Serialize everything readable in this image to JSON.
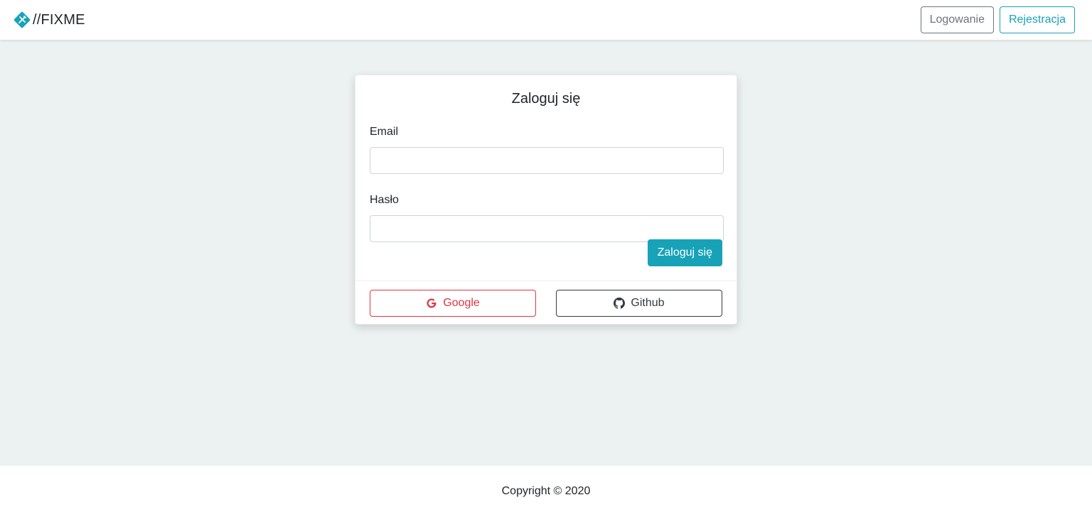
{
  "navbar": {
    "brand_text": "//FIXME",
    "brand_icon": "tools-diamond-icon",
    "login_label": "Logowanie",
    "register_label": "Rejestracja"
  },
  "login_card": {
    "title": "Zaloguj się",
    "email_label": "Email",
    "email_value": "",
    "password_label": "Hasło",
    "password_value": "",
    "submit_label": "Zaloguj się",
    "google_label": "Google",
    "google_icon": "google-icon",
    "github_label": "Github",
    "github_icon": "github-icon"
  },
  "footer": {
    "copyright": "Copyright © 2020"
  },
  "colors": {
    "accent": "#17a2b8",
    "danger": "#dc3545",
    "dark": "#343a40",
    "secondary": "#6c757d",
    "background": "#ecf1f1"
  }
}
